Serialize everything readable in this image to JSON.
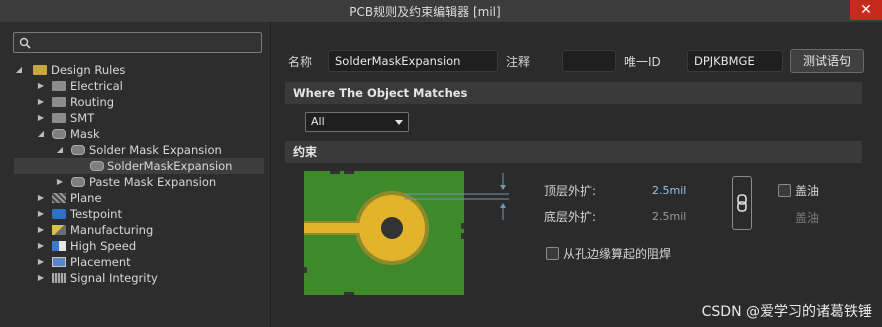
{
  "window": {
    "title": "PCB规则及约束编辑器 [mil]",
    "close_glyph": "✕"
  },
  "search": {
    "placeholder": ""
  },
  "tree": [
    {
      "label": "Design Rules",
      "icon": "design-rules-icon",
      "expanded": true
    },
    {
      "label": "Electrical",
      "icon": "electrical-icon"
    },
    {
      "label": "Routing",
      "icon": "routing-icon"
    },
    {
      "label": "SMT",
      "icon": "smt-icon"
    },
    {
      "label": "Mask",
      "icon": "mask-icon",
      "expanded": true
    },
    {
      "label": "Solder Mask Expansion",
      "icon": "mask-rule-icon",
      "expanded": true
    },
    {
      "label": "SolderMaskExpansion",
      "icon": "mask-rule-icon",
      "selected": true
    },
    {
      "label": "Paste Mask Expansion",
      "icon": "mask-rule-icon"
    },
    {
      "label": "Plane",
      "icon": "plane-icon"
    },
    {
      "label": "Testpoint",
      "icon": "testpoint-icon"
    },
    {
      "label": "Manufacturing",
      "icon": "manufacturing-icon"
    },
    {
      "label": "High Speed",
      "icon": "high-speed-icon"
    },
    {
      "label": "Placement",
      "icon": "placement-icon"
    },
    {
      "label": "Signal Integrity",
      "icon": "signal-integrity-icon"
    }
  ],
  "rule": {
    "name_label": "名称",
    "name_value": "SolderMaskExpansion",
    "comment_label": "注释",
    "comment_value": "",
    "uid_label": "唯一ID",
    "uid_value": "DPJKBMGE",
    "test_button": "测试语句"
  },
  "where": {
    "header": "Where The Object Matches",
    "selected": "All"
  },
  "constraints": {
    "header": "约束",
    "top_label": "顶层外扩:",
    "top_value": "2.5mil",
    "bottom_label": "底层外扩:",
    "bottom_value": "2.5mil",
    "tent_label": "盖油",
    "tent_label_disabled": "盖油",
    "from_hole_label": "从孔边缘算起的阻焊"
  },
  "colors": {
    "board_green": "#3e8a2a",
    "pad_yellow": "#e3b42a",
    "mask_ring": "#8f8a2c",
    "accent_value": "#8fc4ef"
  },
  "watermark": "CSDN @爱学习的诸葛铁锤"
}
